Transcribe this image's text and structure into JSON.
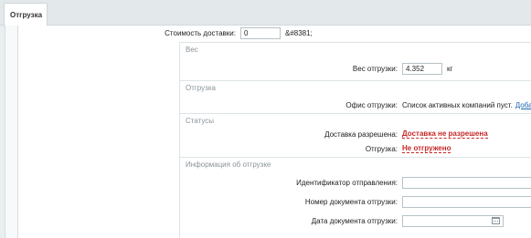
{
  "tabs": [
    {
      "label": "Отгрузка"
    }
  ],
  "delivery": {
    "cost_label": "Стоимость доставки:",
    "cost_value": "0",
    "cost_currency": "&#8381;"
  },
  "weight": {
    "legend": "Вес",
    "label": "Вес отгрузки:",
    "value": "4.352",
    "unit": "кг"
  },
  "shipment": {
    "legend": "Отгрузка",
    "office_label": "Офис отгрузки:",
    "office_text": "Список активных компаний пуст.",
    "add_link": "Добавить"
  },
  "statuses": {
    "legend": "Статусы",
    "delivery_allowed_label": "Доставка разрешена:",
    "delivery_allowed_value": "Доставка не разрешена",
    "shipped_label": "Отгрузка:",
    "shipped_value": "Не отгружено"
  },
  "shipment_info": {
    "legend": "Информация об отгрузке",
    "tracking_label": "Идентификатор отправления:",
    "tracking_value": "",
    "doc_number_label": "Номер документа отгрузки:",
    "doc_number_value": "",
    "doc_date_label": "Дата документа отгрузки:",
    "doc_date_value": ""
  },
  "colors": {
    "status_negative": "#c62828",
    "link": "#2067b0"
  }
}
